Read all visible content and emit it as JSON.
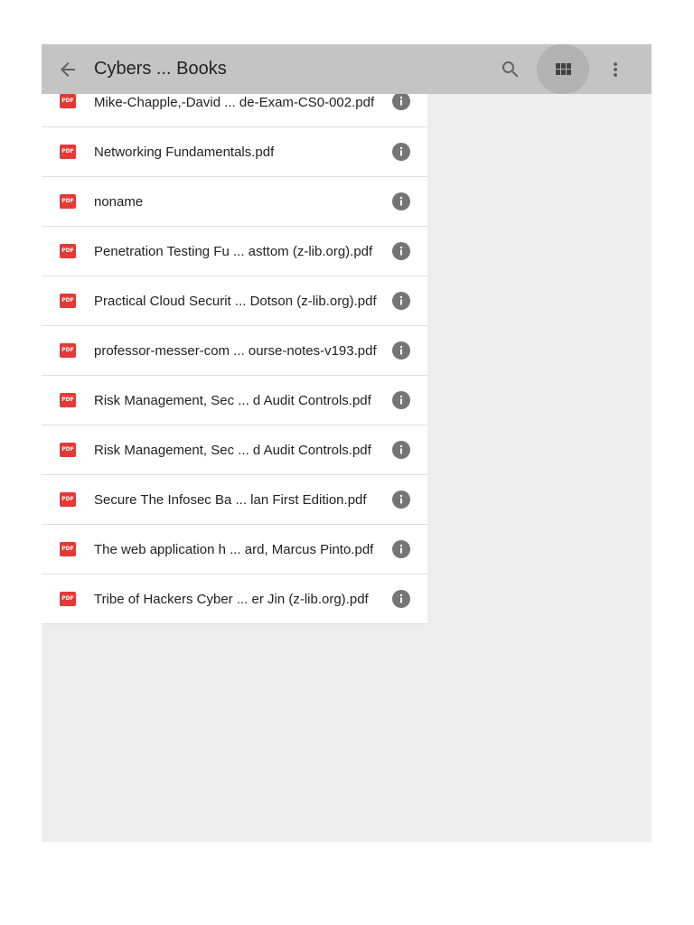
{
  "toolbar": {
    "title": "Cybers ... Books",
    "back_icon": "arrow-back-icon",
    "search_icon": "search-icon",
    "view_icon": "grid-view-icon",
    "more_icon": "more-vert-icon"
  },
  "files": [
    {
      "name": "Mike-Chapple,-David ... de-Exam-CS0-002.pdf",
      "type": "PDF"
    },
    {
      "name": "Networking Fundamentals.pdf",
      "type": "PDF"
    },
    {
      "name": "noname",
      "type": "PDF"
    },
    {
      "name": "Penetration Testing Fu ... asttom (z-lib.org).pdf",
      "type": "PDF"
    },
    {
      "name": "Practical Cloud Securit ... Dotson (z-lib.org).pdf",
      "type": "PDF"
    },
    {
      "name": "professor-messer-com ... ourse-notes-v193.pdf",
      "type": "PDF"
    },
    {
      "name": "Risk Management, Sec ... d Audit Controls.pdf",
      "type": "PDF"
    },
    {
      "name": "Risk Management, Sec ... d Audit Controls.pdf",
      "type": "PDF"
    },
    {
      "name": "Secure The Infosec Ba ... lan First Edition.pdf",
      "type": "PDF"
    },
    {
      "name": "The web application h ... ard, Marcus Pinto.pdf",
      "type": "PDF"
    },
    {
      "name": "Tribe of Hackers Cyber ... er Jin (z-lib.org).pdf",
      "type": "PDF"
    }
  ],
  "colors": {
    "toolbar_bg": "#c4c4c4",
    "pdf_red": "#e53935",
    "info_gray": "#757575",
    "panel_bg": "#eeeeee"
  }
}
